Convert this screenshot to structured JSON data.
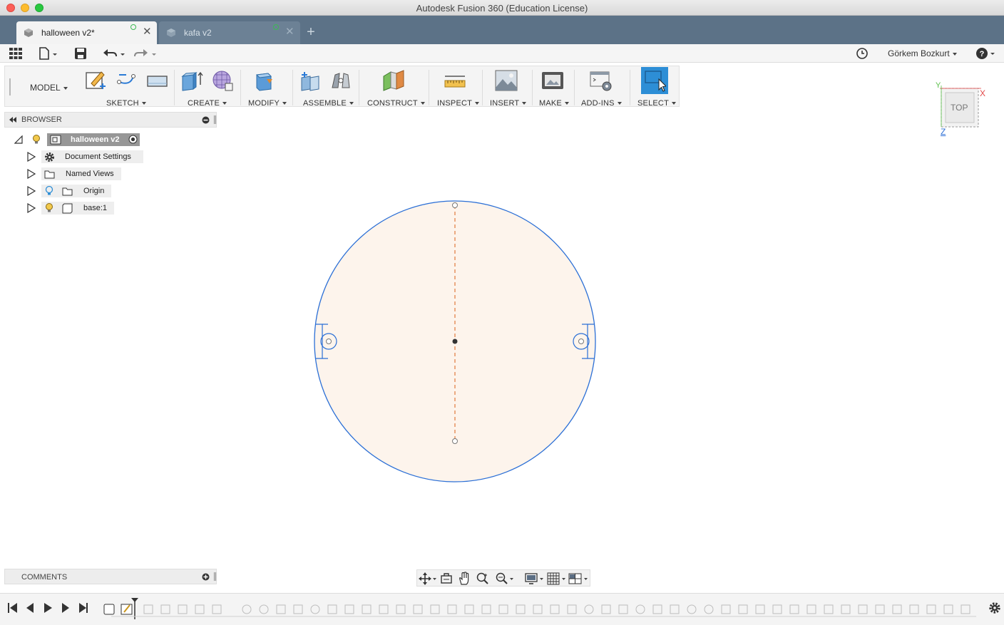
{
  "window": {
    "title": "Autodesk Fusion 360 (Education License)"
  },
  "tabs": [
    {
      "label": "halloween v2*",
      "active": true
    },
    {
      "label": "kafa v2",
      "active": false
    }
  ],
  "quickbar": {
    "user_name": "Görkem Bozkurt",
    "help_label": "?"
  },
  "ribbon": {
    "workspace": "MODEL",
    "groups": [
      {
        "label": "SKETCH"
      },
      {
        "label": "CREATE"
      },
      {
        "label": "MODIFY"
      },
      {
        "label": "ASSEMBLE"
      },
      {
        "label": "CONSTRUCT"
      },
      {
        "label": "INSPECT"
      },
      {
        "label": "INSERT"
      },
      {
        "label": "MAKE"
      },
      {
        "label": "ADD-INS"
      },
      {
        "label": "SELECT"
      }
    ]
  },
  "browser": {
    "title": "BROWSER",
    "root": "halloween v2",
    "items": [
      {
        "label": "Document Settings",
        "icon": "gear-icon"
      },
      {
        "label": "Named Views",
        "icon": "folder-icon"
      },
      {
        "label": "Origin",
        "icon": "folder-icon"
      },
      {
        "label": "base:1",
        "icon": "component-icon"
      }
    ]
  },
  "viewcube": {
    "face": "TOP",
    "axis_x": "X",
    "axis_y": "Y",
    "axis_z": "Z"
  },
  "comments": {
    "title": "COMMENTS"
  },
  "colors": {
    "tabbar": "#5c7287",
    "sketch_fill": "#fdf4ec",
    "sketch_line": "#2b6fd6",
    "construction_line": "#e07a3c",
    "select_active": "#2d8ed6"
  }
}
